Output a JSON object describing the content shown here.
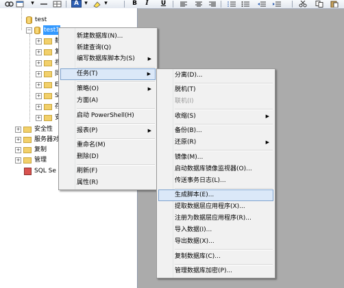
{
  "toolbar": {
    "buttons": [
      {
        "icon": "connect-icon"
      },
      {
        "icon": "new-query-icon"
      },
      {
        "icon": "minus-icon"
      },
      {
        "icon": "table-icon"
      },
      {
        "icon": "font-color-icon",
        "label": "A"
      },
      {
        "icon": "highlight-icon"
      },
      {
        "icon": "bold-icon",
        "label": "B"
      },
      {
        "icon": "italic-icon",
        "label": "I"
      },
      {
        "icon": "underline-icon",
        "label": "U"
      },
      {
        "icon": "align-left-icon"
      },
      {
        "icon": "align-center-icon"
      },
      {
        "icon": "align-right-icon"
      },
      {
        "icon": "numbered-list-icon"
      },
      {
        "icon": "bullet-list-icon"
      },
      {
        "icon": "outdent-icon"
      },
      {
        "icon": "indent-icon"
      },
      {
        "icon": "cut-icon"
      },
      {
        "icon": "copy-icon"
      },
      {
        "icon": "paste-icon"
      }
    ]
  },
  "tree": {
    "db_test": "test",
    "db_selected": "test1",
    "child_fragments": [
      "数",
      "复",
      "视",
      "同",
      "E",
      "S",
      "存",
      "安"
    ],
    "security": "安全性",
    "server_objects": "服务器对",
    "replication": "复制",
    "management": "管理",
    "sql_agent": "SQL Se"
  },
  "context_menu": {
    "items": [
      {
        "label": "新建数据库(N)..."
      },
      {
        "label": "新建查询(Q)"
      },
      {
        "label": "编写数据库脚本为(S)",
        "submenu": true
      },
      {
        "label": "任务(T)",
        "submenu": true,
        "highlighted": true
      },
      {
        "label": "策略(O)",
        "submenu": true
      },
      {
        "label": "方面(A)"
      },
      {
        "label": "启动 PowerShell(H)"
      },
      {
        "label": "报表(P)",
        "submenu": true
      },
      {
        "label": "重命名(M)"
      },
      {
        "label": "删除(D)"
      },
      {
        "label": "刷新(F)"
      },
      {
        "label": "属性(R)"
      }
    ]
  },
  "tasks_menu": {
    "items": [
      {
        "label": "分离(D)..."
      },
      {
        "label": "脱机(T)"
      },
      {
        "label": "联机(I)",
        "disabled": true
      },
      {
        "label": "收缩(S)",
        "submenu": true
      },
      {
        "label": "备份(B)..."
      },
      {
        "label": "还原(R)",
        "submenu": true
      },
      {
        "label": "镜像(M)..."
      },
      {
        "label": "启动数据库镜像监视器(O)..."
      },
      {
        "label": "传送事务日志(L)..."
      },
      {
        "label": "生成脚本(E)...",
        "highlighted": true
      },
      {
        "label": "提取数据层应用程序(X)..."
      },
      {
        "label": "注册为数据层应用程序(R)..."
      },
      {
        "label": "导入数据(I)..."
      },
      {
        "label": "导出数据(X)..."
      },
      {
        "label": "复制数据库(C)..."
      },
      {
        "label": "管理数据库加密(P)..."
      }
    ]
  },
  "colors": {
    "selection": "#3399ff",
    "menu_highlight": "#dbe8f8",
    "menu_highlight_border": "#7da2ce",
    "workspace": "#ababab"
  }
}
